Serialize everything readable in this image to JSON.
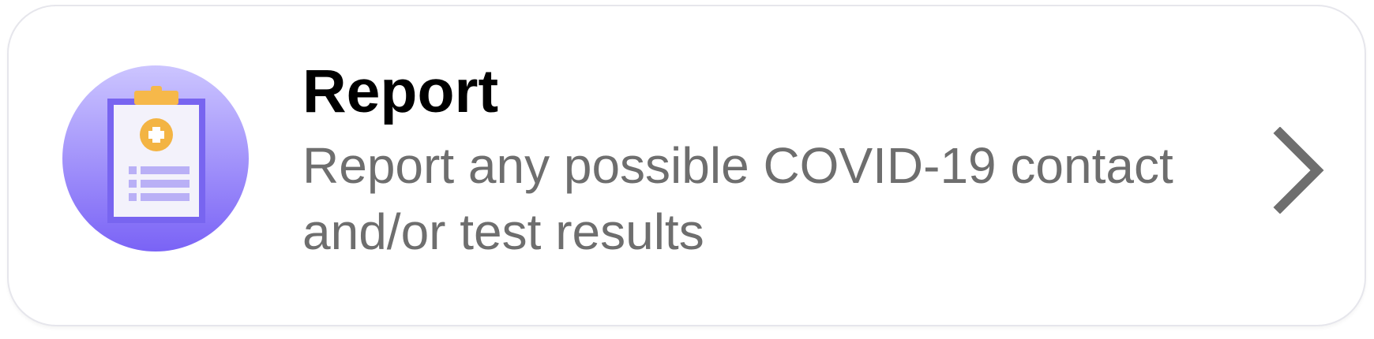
{
  "card": {
    "title": "Report",
    "description": "Report any possible COVID-19 contact and/or test results",
    "icon": "clipboard-medical-icon",
    "action_icon": "chevron-right-icon"
  },
  "colors": {
    "title": "#000000",
    "description": "#6e6e6e",
    "icon_circle_top": "#c9c2ff",
    "icon_circle_bottom": "#7b66f5",
    "clipboard_frame": "#7a67f2",
    "clip": "#f5b546",
    "chevron": "#6e6e6e"
  }
}
